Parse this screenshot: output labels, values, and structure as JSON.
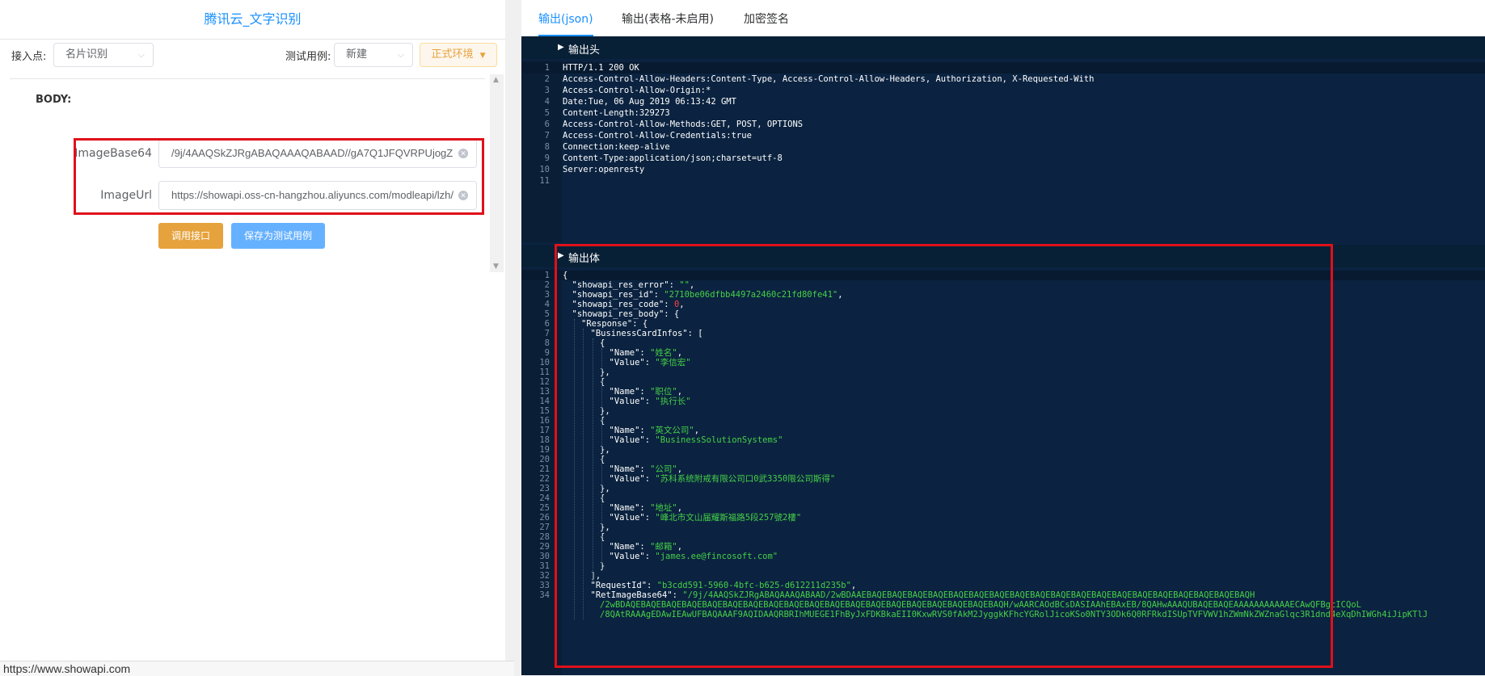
{
  "left": {
    "title": "腾讯云_文字识别",
    "toolbar": {
      "endpoint_label": "接入点:",
      "endpoint_value": "名片识别",
      "testcase_label": "测试用例:",
      "testcase_value": "新建",
      "env_label": "正式环境"
    },
    "body_label": "BODY:",
    "fields": [
      {
        "label": "ImageBase64",
        "value": "/9j/4AAQSkZJRgABAQAAAQABAAD//gA7Q1JFQVRPUjogZ"
      },
      {
        "label": "ImageUrl",
        "value": "https://showapi.oss-cn-hangzhou.aliyuncs.com/modleapi/lzh/"
      }
    ],
    "buttons": {
      "call": "调用接口",
      "save": "保存为测试用例"
    },
    "status_url": "https://www.showapi.com"
  },
  "right": {
    "tabs": [
      "输出(json)",
      "输出(表格-未启用)",
      "加密签名"
    ],
    "header_section_label": "输出头",
    "body_section_label": "输出体",
    "header_lines": [
      "HTTP/1.1 200 OK",
      "Access-Control-Allow-Headers:Content-Type, Access-Control-Allow-Headers, Authorization, X-Requested-With",
      "Access-Control-Allow-Origin:*",
      "Date:Tue, 06 Aug 2019 06:13:42 GMT",
      "Content-Length:329273",
      "Access-Control-Allow-Methods:GET, POST, OPTIONS",
      "Access-Control-Allow-Credentials:true",
      "Connection:keep-alive",
      "Content-Type:application/json;charset=utf-8",
      "Server:openresty",
      ""
    ],
    "body_lines": [
      {
        "n": "1",
        "indent": 0,
        "parts": [
          [
            "p",
            "{"
          ]
        ]
      },
      {
        "n": "2",
        "indent": 1,
        "parts": [
          [
            "p",
            "\"showapi_res_error\": "
          ],
          [
            "s",
            "\"\""
          ],
          [
            "p",
            ","
          ]
        ]
      },
      {
        "n": "3",
        "indent": 1,
        "parts": [
          [
            "p",
            "\"showapi_res_id\": "
          ],
          [
            "s",
            "\"2710be06dfbb4497a2460c21fd80fe41\""
          ],
          [
            "p",
            ","
          ]
        ]
      },
      {
        "n": "4",
        "indent": 1,
        "parts": [
          [
            "p",
            "\"showapi_res_code\": "
          ],
          [
            "n",
            "0"
          ],
          [
            "p",
            ","
          ]
        ]
      },
      {
        "n": "5",
        "indent": 1,
        "parts": [
          [
            "p",
            "\"showapi_res_body\": {"
          ]
        ]
      },
      {
        "n": "6",
        "indent": 2,
        "parts": [
          [
            "p",
            "\"Response\": {"
          ]
        ]
      },
      {
        "n": "7",
        "indent": 3,
        "parts": [
          [
            "p",
            "\"BusinessCardInfos\": ["
          ]
        ]
      },
      {
        "n": "8",
        "indent": 4,
        "parts": [
          [
            "p",
            "{"
          ]
        ]
      },
      {
        "n": "9",
        "indent": 5,
        "parts": [
          [
            "p",
            "\"Name\": "
          ],
          [
            "s",
            "\"姓名\""
          ],
          [
            "p",
            ","
          ]
        ]
      },
      {
        "n": "10",
        "indent": 5,
        "parts": [
          [
            "p",
            "\"Value\": "
          ],
          [
            "s",
            "\"李信宏\""
          ]
        ]
      },
      {
        "n": "11",
        "indent": 4,
        "parts": [
          [
            "p",
            "},"
          ]
        ]
      },
      {
        "n": "12",
        "indent": 4,
        "parts": [
          [
            "p",
            "{"
          ]
        ]
      },
      {
        "n": "13",
        "indent": 5,
        "parts": [
          [
            "p",
            "\"Name\": "
          ],
          [
            "s",
            "\"职位\""
          ],
          [
            "p",
            ","
          ]
        ]
      },
      {
        "n": "14",
        "indent": 5,
        "parts": [
          [
            "p",
            "\"Value\": "
          ],
          [
            "s",
            "\"执行长\""
          ]
        ]
      },
      {
        "n": "15",
        "indent": 4,
        "parts": [
          [
            "p",
            "},"
          ]
        ]
      },
      {
        "n": "16",
        "indent": 4,
        "parts": [
          [
            "p",
            "{"
          ]
        ]
      },
      {
        "n": "17",
        "indent": 5,
        "parts": [
          [
            "p",
            "\"Name\": "
          ],
          [
            "s",
            "\"英文公司\""
          ],
          [
            "p",
            ","
          ]
        ]
      },
      {
        "n": "18",
        "indent": 5,
        "parts": [
          [
            "p",
            "\"Value\": "
          ],
          [
            "s",
            "\"BusinessSolutionSystems\""
          ]
        ]
      },
      {
        "n": "19",
        "indent": 4,
        "parts": [
          [
            "p",
            "},"
          ]
        ]
      },
      {
        "n": "20",
        "indent": 4,
        "parts": [
          [
            "p",
            "{"
          ]
        ]
      },
      {
        "n": "21",
        "indent": 5,
        "parts": [
          [
            "p",
            "\"Name\": "
          ],
          [
            "s",
            "\"公司\""
          ],
          [
            "p",
            ","
          ]
        ]
      },
      {
        "n": "22",
        "indent": 5,
        "parts": [
          [
            "p",
            "\"Value\": "
          ],
          [
            "s",
            "\"苏科系统附戒有限公司口0武3350限公司斯得\""
          ]
        ]
      },
      {
        "n": "23",
        "indent": 4,
        "parts": [
          [
            "p",
            "},"
          ]
        ]
      },
      {
        "n": "24",
        "indent": 4,
        "parts": [
          [
            "p",
            "{"
          ]
        ]
      },
      {
        "n": "25",
        "indent": 5,
        "parts": [
          [
            "p",
            "\"Name\": "
          ],
          [
            "s",
            "\"地址\""
          ],
          [
            "p",
            ","
          ]
        ]
      },
      {
        "n": "26",
        "indent": 5,
        "parts": [
          [
            "p",
            "\"Value\": "
          ],
          [
            "s",
            "\"峰北市文山届耀斯福路5段257號2樓\""
          ]
        ]
      },
      {
        "n": "27",
        "indent": 4,
        "parts": [
          [
            "p",
            "},"
          ]
        ]
      },
      {
        "n": "28",
        "indent": 4,
        "parts": [
          [
            "p",
            "{"
          ]
        ]
      },
      {
        "n": "29",
        "indent": 5,
        "parts": [
          [
            "p",
            "\"Name\": "
          ],
          [
            "s",
            "\"邮箱\""
          ],
          [
            "p",
            ","
          ]
        ]
      },
      {
        "n": "30",
        "indent": 5,
        "parts": [
          [
            "p",
            "\"Value\": "
          ],
          [
            "s",
            "\"james.ee@fincosoft.com\""
          ]
        ]
      },
      {
        "n": "31",
        "indent": 4,
        "parts": [
          [
            "p",
            "}"
          ]
        ]
      },
      {
        "n": "32",
        "indent": 3,
        "parts": [
          [
            "p",
            "],"
          ]
        ]
      },
      {
        "n": "33",
        "indent": 3,
        "parts": [
          [
            "p",
            "\"RequestId\": "
          ],
          [
            "s",
            "\"b3cdd591-5960-4bfc-b625-d612211d235b\""
          ],
          [
            "p",
            ","
          ]
        ]
      },
      {
        "n": "34",
        "indent": 3,
        "parts": [
          [
            "p",
            "\"RetImageBase64\": "
          ],
          [
            "s",
            "\"/9j/4AAQSkZJRgABAQAAAQABAAD/2wBDAAEBAQEBAQEBAQEBAQEBAQEBAQEBAQEBAQEBAQEBAQEBAQEBAQEBAQEBAQEBAQEBAQEBAQEBAQEBAQH"
          ]
        ]
      },
      {
        "n": "",
        "indent": 4,
        "parts": [
          [
            "s",
            "/2wBDAQEBAQEBAQEBAQEBAQEBAQEBAQEBAQEBAQEBAQEBAQEBAQEBAQEBAQEBAQEBAQEBAQEBAQEBAQH/wAARCAOdBCsDASIAAhEBAxEB/8QAHwAAAQUBAQEBAQEAAAAAAAAAAAECAwQFBgcICQoL"
          ]
        ]
      },
      {
        "n": "",
        "indent": 4,
        "parts": [
          [
            "s",
            "/8QAtRAAAgEDAwIEAwUFBAQAAAF9AQIDAAQRBRIhMUEGE1FhByJxFDKBkaEII0KxwRVS0fAkM2JyggkKFhcYGRolJicoKSo0NTY3ODk6Q0RFRkdISUpTVFVWV1hZWmNkZWZnaGlqc3R1dnd4eXqDhIWGh4iJipKTlJ"
          ]
        ]
      }
    ]
  }
}
